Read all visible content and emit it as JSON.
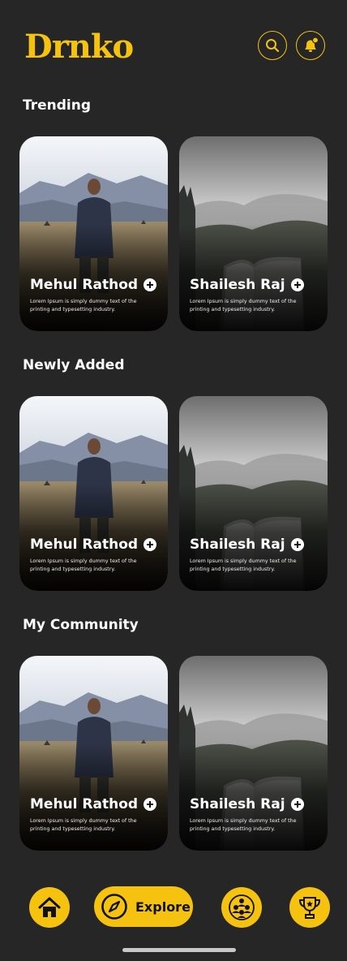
{
  "app": {
    "logo_text": "Drnko"
  },
  "colors": {
    "accent": "#f5c30f",
    "background": "#262626"
  },
  "header": {
    "search_icon": "search-icon",
    "bell_icon": "bell-icon"
  },
  "sections": [
    {
      "title": "Trending",
      "cards": [
        {
          "name": "Mehul Rathod",
          "desc": "Lorem Ipsum is simply dummy text of the printing and typesetting industry.",
          "image": "man-in-field"
        },
        {
          "name": "Shailesh Raj",
          "desc": "Lorem Ipsum is simply dummy text of the printing and typesetting industry.",
          "image": "book-mountains"
        }
      ]
    },
    {
      "title": "Newly Added",
      "cards": [
        {
          "name": "Mehul Rathod",
          "desc": "Lorem Ipsum is simply dummy text of the printing and typesetting industry.",
          "image": "man-in-field"
        },
        {
          "name": "Shailesh Raj",
          "desc": "Lorem Ipsum is simply dummy text of the printing and typesetting industry.",
          "image": "book-mountains"
        }
      ]
    },
    {
      "title": "My Community",
      "cards": [
        {
          "name": "Mehul Rathod",
          "desc": "Lorem Ipsum is simply dummy text of the printing and typesetting industry.",
          "image": "man-in-field"
        },
        {
          "name": "Shailesh Raj",
          "desc": "Lorem Ipsum is simply dummy text of the printing and typesetting industry.",
          "image": "book-mountains"
        }
      ]
    }
  ],
  "nav": {
    "home_icon": "home-icon",
    "explore_label": "Explore",
    "explore_icon": "compass-icon",
    "community_icon": "community-icon",
    "trophy_icon": "trophy-icon"
  }
}
